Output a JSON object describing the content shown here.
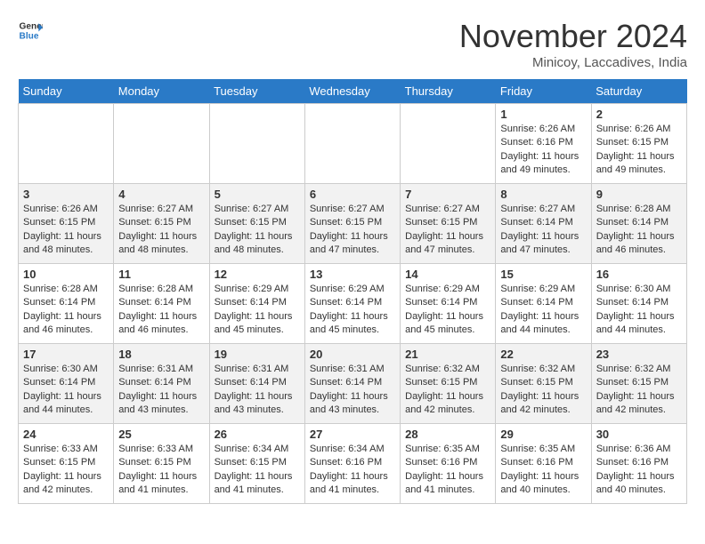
{
  "header": {
    "logo_line1": "General",
    "logo_line2": "Blue",
    "month": "November 2024",
    "location": "Minicoy, Laccadives, India"
  },
  "days_of_week": [
    "Sunday",
    "Monday",
    "Tuesday",
    "Wednesday",
    "Thursday",
    "Friday",
    "Saturday"
  ],
  "weeks": [
    [
      {
        "day": "",
        "info": ""
      },
      {
        "day": "",
        "info": ""
      },
      {
        "day": "",
        "info": ""
      },
      {
        "day": "",
        "info": ""
      },
      {
        "day": "",
        "info": ""
      },
      {
        "day": "1",
        "info": "Sunrise: 6:26 AM\nSunset: 6:16 PM\nDaylight: 11 hours and 49 minutes."
      },
      {
        "day": "2",
        "info": "Sunrise: 6:26 AM\nSunset: 6:15 PM\nDaylight: 11 hours and 49 minutes."
      }
    ],
    [
      {
        "day": "3",
        "info": "Sunrise: 6:26 AM\nSunset: 6:15 PM\nDaylight: 11 hours and 48 minutes."
      },
      {
        "day": "4",
        "info": "Sunrise: 6:27 AM\nSunset: 6:15 PM\nDaylight: 11 hours and 48 minutes."
      },
      {
        "day": "5",
        "info": "Sunrise: 6:27 AM\nSunset: 6:15 PM\nDaylight: 11 hours and 48 minutes."
      },
      {
        "day": "6",
        "info": "Sunrise: 6:27 AM\nSunset: 6:15 PM\nDaylight: 11 hours and 47 minutes."
      },
      {
        "day": "7",
        "info": "Sunrise: 6:27 AM\nSunset: 6:15 PM\nDaylight: 11 hours and 47 minutes."
      },
      {
        "day": "8",
        "info": "Sunrise: 6:27 AM\nSunset: 6:14 PM\nDaylight: 11 hours and 47 minutes."
      },
      {
        "day": "9",
        "info": "Sunrise: 6:28 AM\nSunset: 6:14 PM\nDaylight: 11 hours and 46 minutes."
      }
    ],
    [
      {
        "day": "10",
        "info": "Sunrise: 6:28 AM\nSunset: 6:14 PM\nDaylight: 11 hours and 46 minutes."
      },
      {
        "day": "11",
        "info": "Sunrise: 6:28 AM\nSunset: 6:14 PM\nDaylight: 11 hours and 46 minutes."
      },
      {
        "day": "12",
        "info": "Sunrise: 6:29 AM\nSunset: 6:14 PM\nDaylight: 11 hours and 45 minutes."
      },
      {
        "day": "13",
        "info": "Sunrise: 6:29 AM\nSunset: 6:14 PM\nDaylight: 11 hours and 45 minutes."
      },
      {
        "day": "14",
        "info": "Sunrise: 6:29 AM\nSunset: 6:14 PM\nDaylight: 11 hours and 45 minutes."
      },
      {
        "day": "15",
        "info": "Sunrise: 6:29 AM\nSunset: 6:14 PM\nDaylight: 11 hours and 44 minutes."
      },
      {
        "day": "16",
        "info": "Sunrise: 6:30 AM\nSunset: 6:14 PM\nDaylight: 11 hours and 44 minutes."
      }
    ],
    [
      {
        "day": "17",
        "info": "Sunrise: 6:30 AM\nSunset: 6:14 PM\nDaylight: 11 hours and 44 minutes."
      },
      {
        "day": "18",
        "info": "Sunrise: 6:31 AM\nSunset: 6:14 PM\nDaylight: 11 hours and 43 minutes."
      },
      {
        "day": "19",
        "info": "Sunrise: 6:31 AM\nSunset: 6:14 PM\nDaylight: 11 hours and 43 minutes."
      },
      {
        "day": "20",
        "info": "Sunrise: 6:31 AM\nSunset: 6:14 PM\nDaylight: 11 hours and 43 minutes."
      },
      {
        "day": "21",
        "info": "Sunrise: 6:32 AM\nSunset: 6:15 PM\nDaylight: 11 hours and 42 minutes."
      },
      {
        "day": "22",
        "info": "Sunrise: 6:32 AM\nSunset: 6:15 PM\nDaylight: 11 hours and 42 minutes."
      },
      {
        "day": "23",
        "info": "Sunrise: 6:32 AM\nSunset: 6:15 PM\nDaylight: 11 hours and 42 minutes."
      }
    ],
    [
      {
        "day": "24",
        "info": "Sunrise: 6:33 AM\nSunset: 6:15 PM\nDaylight: 11 hours and 42 minutes."
      },
      {
        "day": "25",
        "info": "Sunrise: 6:33 AM\nSunset: 6:15 PM\nDaylight: 11 hours and 41 minutes."
      },
      {
        "day": "26",
        "info": "Sunrise: 6:34 AM\nSunset: 6:15 PM\nDaylight: 11 hours and 41 minutes."
      },
      {
        "day": "27",
        "info": "Sunrise: 6:34 AM\nSunset: 6:16 PM\nDaylight: 11 hours and 41 minutes."
      },
      {
        "day": "28",
        "info": "Sunrise: 6:35 AM\nSunset: 6:16 PM\nDaylight: 11 hours and 41 minutes."
      },
      {
        "day": "29",
        "info": "Sunrise: 6:35 AM\nSunset: 6:16 PM\nDaylight: 11 hours and 40 minutes."
      },
      {
        "day": "30",
        "info": "Sunrise: 6:36 AM\nSunset: 6:16 PM\nDaylight: 11 hours and 40 minutes."
      }
    ]
  ]
}
